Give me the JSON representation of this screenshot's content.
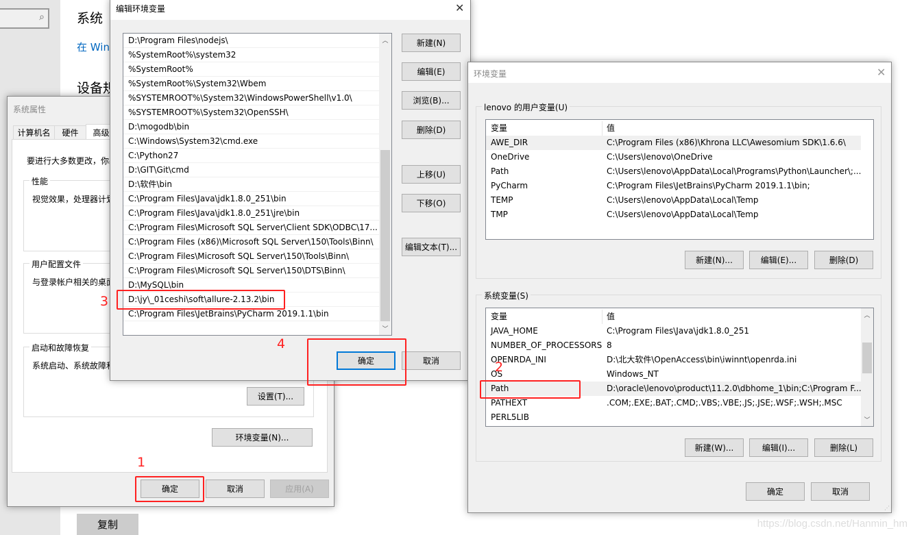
{
  "settings_bg": {
    "title": "系统",
    "link": "在 Wind",
    "section": "设备规",
    "copy_button": "复制",
    "search_icon": "search-icon"
  },
  "sys_props": {
    "title": "系统属性",
    "tabs": [
      "计算机名",
      "硬件",
      "高级"
    ],
    "active_tab": "高级",
    "intro": "要进行大多数更改，你必须作为管理员登录。",
    "groups": [
      {
        "label": "性能",
        "text": "视觉效果，处理器计划，内存使用，以及虚拟内存"
      },
      {
        "label": "用户配置文件",
        "text": "与登录帐户相关的桌面设置"
      },
      {
        "label": "启动和故障恢复",
        "text": "系统启动、系统故障和调试信息"
      }
    ],
    "settings_button": "设置(T)...",
    "env_button": "环境变量(N)...",
    "ok": "确定",
    "cancel": "取消",
    "apply": "应用(A)"
  },
  "edit_env": {
    "title": "编辑环境变量",
    "entries": [
      "D:\\Program Files\\nodejs\\",
      "%SystemRoot%\\system32",
      "%SystemRoot%",
      "%SystemRoot%\\System32\\Wbem",
      "%SYSTEMROOT%\\System32\\WindowsPowerShell\\v1.0\\",
      "%SYSTEMROOT%\\System32\\OpenSSH\\",
      "D:\\mogodb\\bin",
      "C:\\Windows\\System32\\cmd.exe",
      "C:\\Python27",
      "D:\\GIT\\Git\\cmd",
      "D:\\软件\\bin",
      "C:\\Program Files\\Java\\jdk1.8.0_251\\bin",
      "C:\\Program Files\\Java\\jdk1.8.0_251\\jre\\bin",
      "C:\\Program Files\\Microsoft SQL Server\\Client SDK\\ODBC\\17...",
      "C:\\Program Files (x86)\\Microsoft SQL Server\\150\\Tools\\Binn\\",
      "C:\\Program Files\\Microsoft SQL Server\\150\\Tools\\Binn\\",
      "C:\\Program Files\\Microsoft SQL Server\\150\\DTS\\Binn\\",
      "D:\\MySQL\\bin",
      "D:\\jy\\_01ceshi\\soft\\allure-2.13.2\\bin",
      "C:\\Program Files\\JetBrains\\PyCharm 2019.1.1\\bin"
    ],
    "buttons": [
      "新建(N)",
      "编辑(E)",
      "浏览(B)...",
      "删除(D)",
      "上移(U)",
      "下移(O)",
      "编辑文本(T)..."
    ],
    "ok": "确定",
    "cancel": "取消"
  },
  "env_vars": {
    "title": "环境变量",
    "user_group": "lenovo 的用户变量(U)",
    "col_name": "变量",
    "col_value": "值",
    "user_vars": [
      {
        "name": "AWE_DIR",
        "value": "C:\\Program Files (x86)\\Khrona LLC\\Awesomium SDK\\1.6.6\\"
      },
      {
        "name": "OneDrive",
        "value": "C:\\Users\\lenovo\\OneDrive"
      },
      {
        "name": "Path",
        "value": "C:\\Users\\lenovo\\AppData\\Local\\Programs\\Python\\Launcher\\;..."
      },
      {
        "name": "PyCharm",
        "value": "C:\\Program Files\\JetBrains\\PyCharm 2019.1.1\\bin;"
      },
      {
        "name": "TEMP",
        "value": "C:\\Users\\lenovo\\AppData\\Local\\Temp"
      },
      {
        "name": "TMP",
        "value": "C:\\Users\\lenovo\\AppData\\Local\\Temp"
      }
    ],
    "user_buttons": [
      "新建(N)...",
      "编辑(E)...",
      "删除(D)"
    ],
    "sys_group": "系统变量(S)",
    "sys_vars": [
      {
        "name": "JAVA_HOME",
        "value": "C:\\Program Files\\Java\\jdk1.8.0_251"
      },
      {
        "name": "NUMBER_OF_PROCESSORS",
        "value": "8"
      },
      {
        "name": "OPENRDA_INI",
        "value": "D:\\北大软件\\OpenAccess\\bin\\iwinnt\\openrda.ini"
      },
      {
        "name": "OS",
        "value": "Windows_NT"
      },
      {
        "name": "Path",
        "value": "D:\\oracle\\lenovo\\product\\11.2.0\\dbhome_1\\bin;C:\\Program F..."
      },
      {
        "name": "PATHEXT",
        "value": ".COM;.EXE;.BAT;.CMD;.VBS;.VBE;.JS;.JSE;.WSF;.WSH;.MSC"
      },
      {
        "name": "PERL5LIB",
        "value": ""
      }
    ],
    "sys_buttons": [
      "新建(W)...",
      "编辑(I)...",
      "删除(L)"
    ],
    "ok": "确定",
    "cancel": "取消"
  },
  "annotations": [
    "1",
    "2",
    "3",
    "4"
  ],
  "annotation_color": "#ff2020",
  "watermark": "https://blog.csdn.net/Hanmin_hm"
}
